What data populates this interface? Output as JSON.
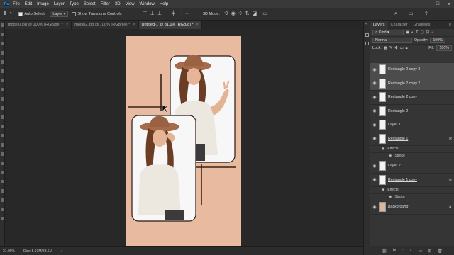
{
  "menu": [
    "File",
    "Edit",
    "Image",
    "Layer",
    "Type",
    "Select",
    "Filter",
    "3D",
    "View",
    "Window",
    "Help"
  ],
  "window_controls": [
    "–",
    "□",
    "✕"
  ],
  "options": {
    "auto_select_label": "Auto-Select:",
    "auto_select_value": "Layer",
    "transform_controls_label": "Show Transform Controls",
    "mode_3d": "3D Mode:"
  },
  "tabs": [
    {
      "label": "model0.jpg @ 100% (RGB/8#) *",
      "active": false
    },
    {
      "label": "model2.jpg @ 100% (RGB/8#) *",
      "active": false
    },
    {
      "label": "Untitled-1 @ 31.1% (RGB/8) *",
      "active": true
    }
  ],
  "status": {
    "zoom": "31.09%",
    "doc": "Doc: 5.93M/33.6M"
  },
  "panel": {
    "tabs": [
      "Layers",
      "Character",
      "Gradients"
    ],
    "kind": "Kind",
    "blend_mode": "Normal",
    "opacity_label": "Opacity:",
    "opacity_value": "100%",
    "lock_label": "Lock:",
    "fill_label": "Fill:",
    "fill_value": "100%"
  },
  "layers": [
    {
      "name": "Rectangle 2 copy 3",
      "selected": true,
      "underline": false,
      "fx": false,
      "type": "layer"
    },
    {
      "name": "Rectangle 2 copy 2",
      "selected": true,
      "underline": false,
      "fx": false,
      "type": "layer"
    },
    {
      "name": "Rectangle 2 copy",
      "selected": false,
      "underline": false,
      "fx": false,
      "type": "layer"
    },
    {
      "name": "Rectangle 2",
      "selected": false,
      "underline": false,
      "fx": false,
      "type": "layer"
    },
    {
      "name": "Layer 1",
      "selected": false,
      "underline": false,
      "fx": false,
      "type": "layer"
    },
    {
      "name": "Rectangle 1",
      "selected": false,
      "underline": true,
      "fx": true,
      "type": "layer"
    },
    {
      "name": "Effects",
      "type": "sub"
    },
    {
      "name": "Stroke",
      "type": "sub"
    },
    {
      "name": "Layer 2",
      "selected": false,
      "underline": false,
      "fx": false,
      "type": "layer"
    },
    {
      "name": "Rectangle 1 copy",
      "selected": false,
      "underline": true,
      "fx": true,
      "type": "layer"
    },
    {
      "name": "Effects",
      "type": "sub"
    },
    {
      "name": "Stroke",
      "type": "sub"
    },
    {
      "name": "Background",
      "selected": false,
      "underline": false,
      "fx": false,
      "type": "background"
    }
  ],
  "colors": {
    "canvas_bg": "#e8baa0",
    "line": "#3b2216",
    "frame_border": "#2a1a12"
  }
}
